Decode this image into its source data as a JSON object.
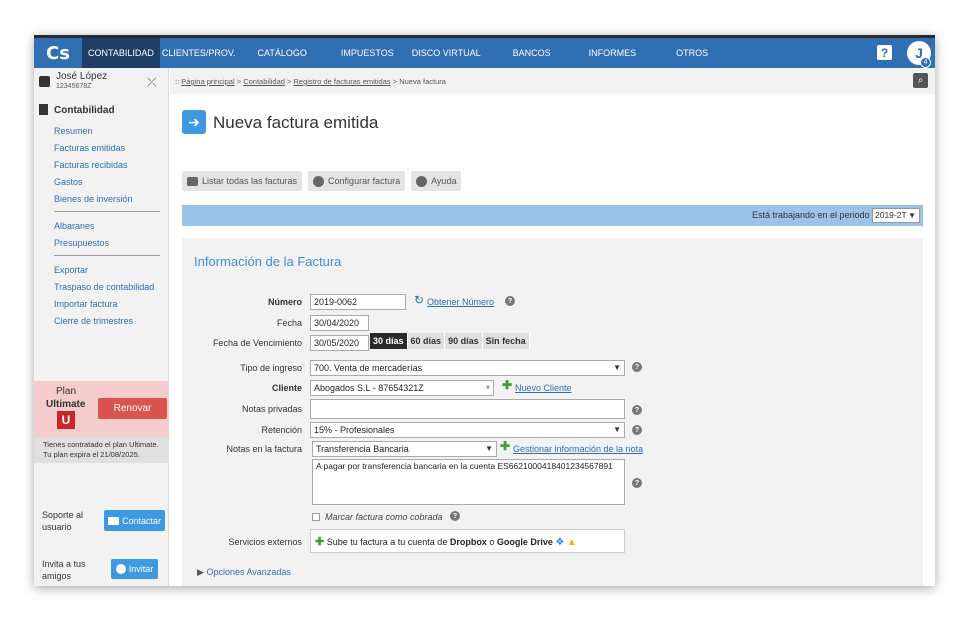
{
  "app": {
    "logo": "Cs",
    "nav": [
      "CONTABILIDAD",
      "CLIENTES/PROV.",
      "CATÁLOGO",
      "IMPUESTOS",
      "DISCO VIRTUAL",
      "BANCOS",
      "INFORMES",
      "OTROS"
    ],
    "help_label": "?",
    "avatar_letter": "J",
    "avatar_badge": "4",
    "brand_color": "#2f6fb2"
  },
  "user": {
    "name": "José López",
    "id": "12345678Z"
  },
  "breadcrumb": {
    "prefix": "::",
    "items": [
      "Página principal",
      "Contabilidad",
      "Registro de facturas emitidas"
    ],
    "current": "Nueva factura",
    "sep": ">"
  },
  "sidebar": {
    "section": "Contabilidad",
    "group1": [
      "Resumen",
      "Facturas emitidas",
      "Facturas recibidas",
      "Gastos",
      "Bienes de inversión"
    ],
    "group2": [
      "Albaranes",
      "Presupuestos"
    ],
    "group3": [
      "Exportar",
      "Traspaso de contabilidad",
      "Importar factura",
      "Cierre de trimestres"
    ],
    "plan": {
      "label": "Plan",
      "name": "Ultimate",
      "badge": "U",
      "renew": "Renovar"
    },
    "plan_note_1": "Tienes contratado el plan Ultimate.",
    "plan_note_2": "Tu plan expira el 21/08/2025.",
    "support_1": "Soporte al",
    "support_2": "usuario",
    "contact": "Contactar",
    "invite_1": "Invita a tus",
    "invite_2": "amigos",
    "invite": "Invitar"
  },
  "page": {
    "title": "Nueva factura emitida",
    "toolbar": [
      "Listar todas las facturas",
      "Configurar factura",
      "Ayuda"
    ],
    "period_text": "Está trabajando en el periodo",
    "period_value": "2019-2T"
  },
  "form": {
    "title": "Información de la Factura",
    "numero_label": "Número",
    "numero_value": "2019-0062",
    "obtener": "Obtener Número",
    "fecha_label": "Fecha",
    "fecha_value": "30/04/2020",
    "venc_label": "Fecha de Vencimiento",
    "venc_value": "30/05/2020",
    "venc_options": [
      "30 días",
      "60 días",
      "90 días",
      "Sin fecha"
    ],
    "tipo_label": "Tipo de ingreso",
    "tipo_value": "700. Venta de mercaderías",
    "cliente_label": "Cliente",
    "cliente_value": "Abogados S.L - 87654321Z",
    "nuevo_cliente": "Nuevo Cliente",
    "notas_priv_label": "Notas privadas",
    "retencion_label": "Retención",
    "retencion_value": "15% - Profesionales",
    "notas_fact_label": "Notas en la factura",
    "notas_fact_select": "Transferencia Bancaria",
    "gestionar": "Gestionar información de la nota",
    "notas_fact_text": "A pagar por transferencia bancaria en la cuenta ES6621000418401234567891",
    "marcar": "Marcar factura como cobrada",
    "servicios_label": "Servicios externos",
    "servicios_pre": "Sube tu factura a tu cuenta de",
    "dropbox": "Dropbox",
    "o": "o",
    "gdrive": "Google Drive",
    "avanzadas": "Opciones Avanzadas"
  }
}
